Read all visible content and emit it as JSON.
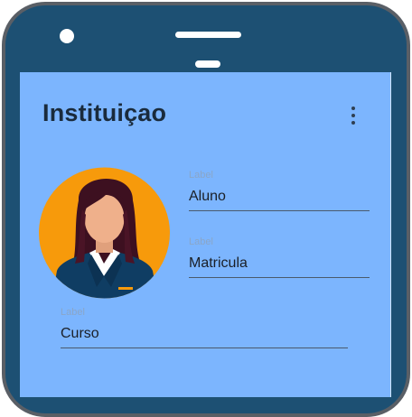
{
  "colors": {
    "phone_frame": "#1d5073",
    "phone_border": "#5a5f66",
    "screen_bg": "#7cb5fe",
    "avatar_bg": "#f79a0b"
  },
  "header": {
    "title": "Instituiçao",
    "menu_icon": "more-vert-icon"
  },
  "profile": {
    "avatar_icon": "female-user-avatar"
  },
  "fields": {
    "aluno": {
      "label": "Label",
      "value": "Aluno"
    },
    "matricula": {
      "label": "Label",
      "value": "Matricula"
    },
    "curso": {
      "label": "Label",
      "value": "Curso"
    }
  }
}
